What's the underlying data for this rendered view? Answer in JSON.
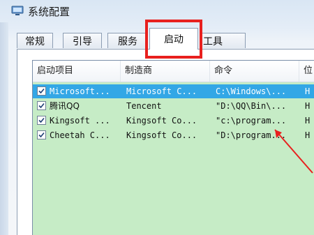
{
  "window": {
    "title": "系统配置"
  },
  "tabs": [
    {
      "label": "常规",
      "active": false
    },
    {
      "label": "引导",
      "active": false
    },
    {
      "label": "服务",
      "active": false
    },
    {
      "label": "启动",
      "active": true
    },
    {
      "label": "工具",
      "active": false
    }
  ],
  "startup": {
    "columns": [
      "启动项目",
      "制造商",
      "命令",
      "位"
    ],
    "rows": [
      {
        "checked": true,
        "item": "Microsoft...",
        "maker": "Microsoft C...",
        "command": "C:\\Windows\\...",
        "location": "H",
        "selected": true
      },
      {
        "checked": true,
        "item": "腾讯QQ",
        "maker": "Tencent",
        "command": "\"D:\\QQ\\Bin\\...",
        "location": "H",
        "selected": false
      },
      {
        "checked": true,
        "item": "Kingsoft ...",
        "maker": "Kingsoft Co...",
        "command": "\"c:\\program...",
        "location": "H",
        "selected": false
      },
      {
        "checked": true,
        "item": "Cheetah C...",
        "maker": "Kingsoft Co...",
        "command": "\"D:\\program...",
        "location": "H",
        "selected": false
      }
    ]
  },
  "colors": {
    "highlight_box": "#e8201e",
    "list_background": "#c6ecc6",
    "selected_row": "#33a7e6"
  }
}
